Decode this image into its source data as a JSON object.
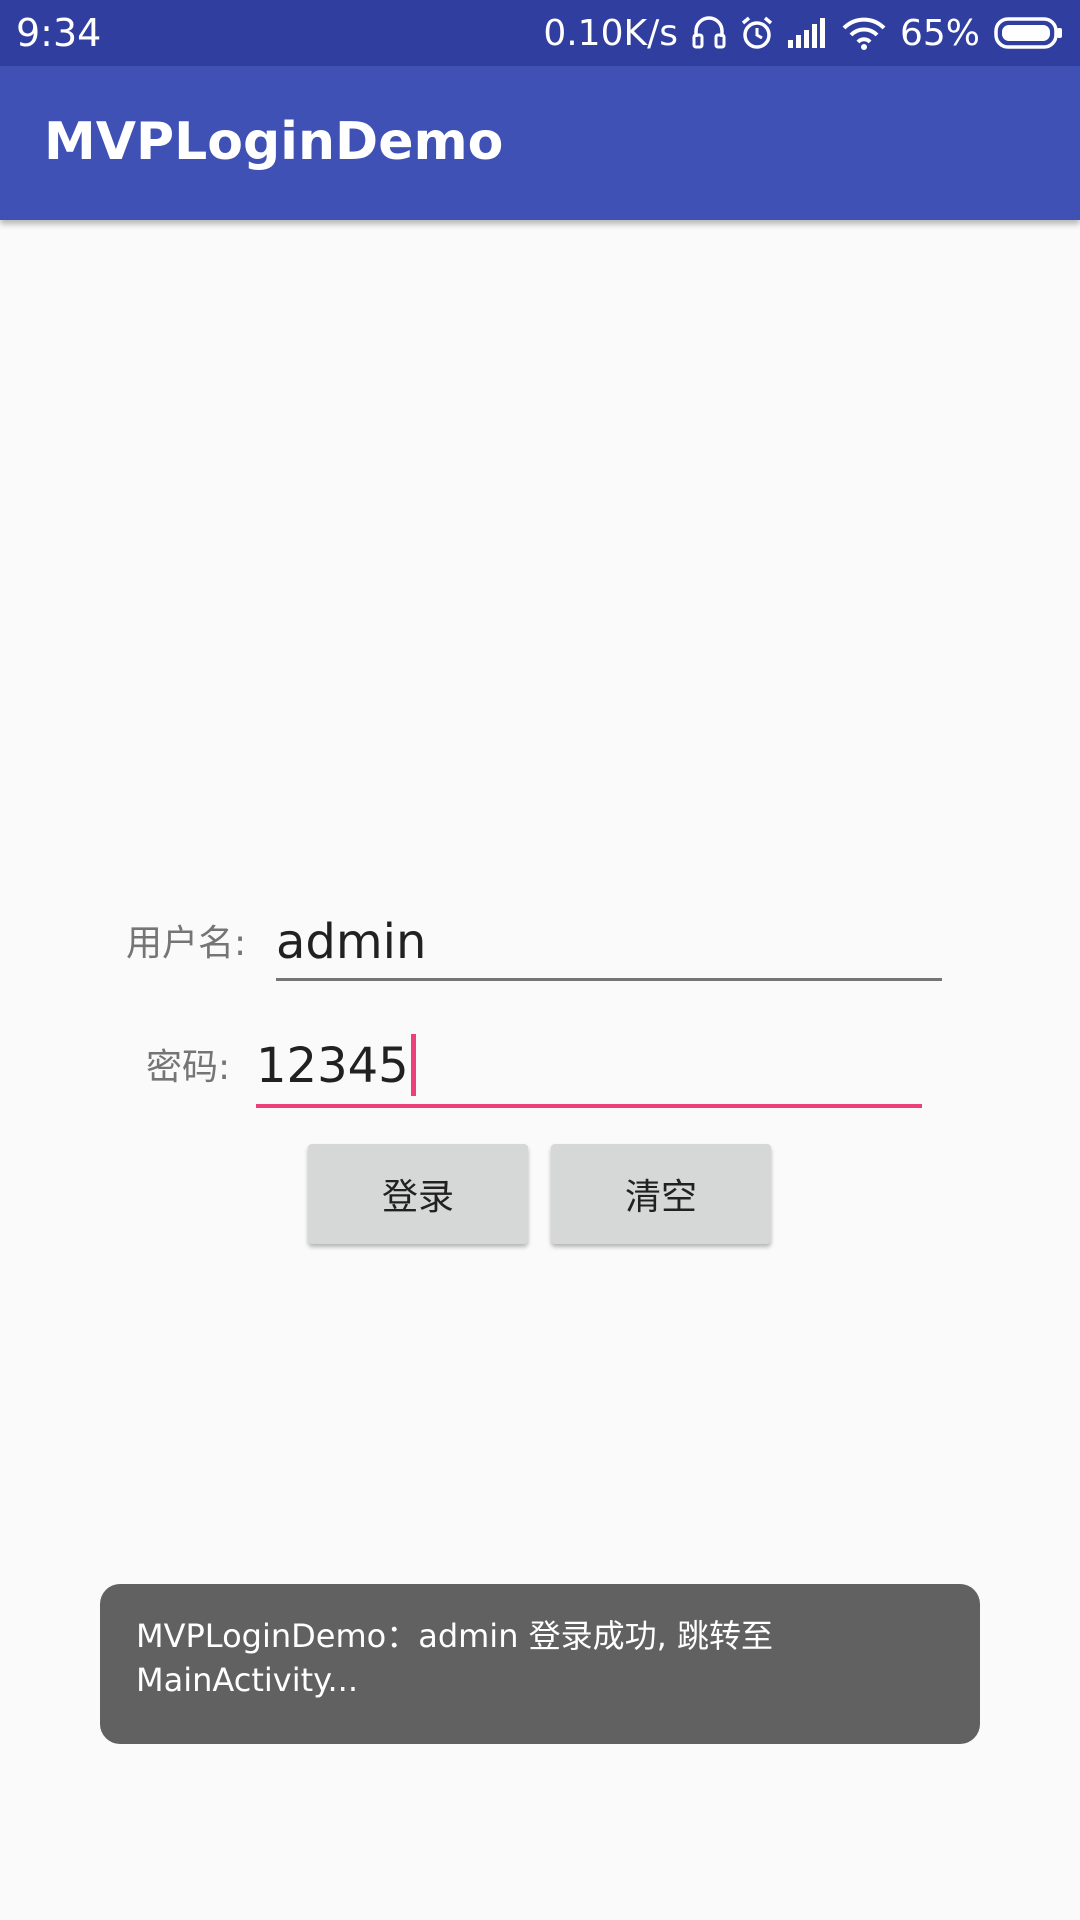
{
  "status_bar": {
    "time": "9:34",
    "net_speed": "0.10K/s",
    "battery": "65%",
    "icons": [
      "headset-icon",
      "alarm-icon",
      "signal-icon",
      "wifi-icon",
      "battery-icon"
    ]
  },
  "app_bar": {
    "title": "MVPLoginDemo"
  },
  "form": {
    "username_label": "用户名:",
    "username_value": "admin",
    "password_label": "密码:",
    "password_value": "12345",
    "login_button": "登录",
    "clear_button": "清空"
  },
  "toast": {
    "message": "MVPLoginDemo：admin 登录成功, 跳转至 MainActivity..."
  },
  "colors": {
    "status_bar": "#303f9f",
    "primary": "#3f51b5",
    "accent": "#ec407a",
    "background": "#fafafa",
    "toast": "#616161"
  }
}
